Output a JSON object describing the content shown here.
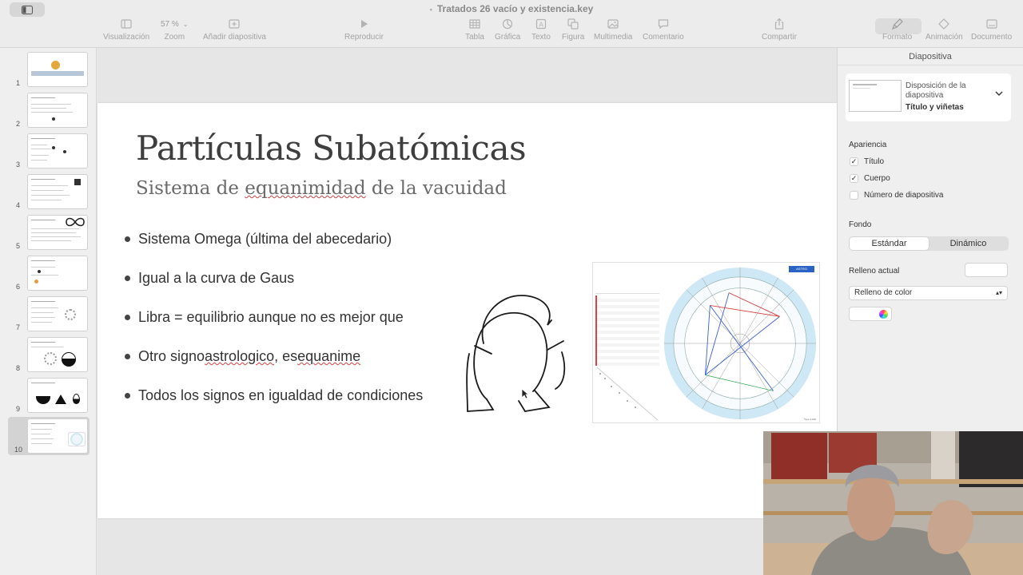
{
  "window": {
    "title": "Tratados 26 vacío y existencia.key"
  },
  "toolbar": {
    "view": "Visualización",
    "zoom_value": "57 %",
    "zoom": "Zoom",
    "add_slide": "Añadir diapositiva",
    "play": "Reproducir",
    "table": "Tabla",
    "chart": "Gráfica",
    "text": "Texto",
    "shape": "Figura",
    "media": "Multimedia",
    "comment": "Comentario",
    "share": "Compartir",
    "format": "Formato",
    "animate": "Animación",
    "document": "Documento"
  },
  "navigator": {
    "slides": [
      {
        "num": "1"
      },
      {
        "num": "2"
      },
      {
        "num": "3"
      },
      {
        "num": "4"
      },
      {
        "num": "5"
      },
      {
        "num": "6"
      },
      {
        "num": "7"
      },
      {
        "num": "8"
      },
      {
        "num": "9"
      },
      {
        "num": "10"
      }
    ],
    "selected": "10"
  },
  "slide": {
    "title": "Partículas Subatómicas",
    "subtitle_pre": "Sistema de ",
    "subtitle_mark": "equanimidad",
    "subtitle_post": " de la vacuidad",
    "bullets": [
      {
        "pre": "Sistema Omega (última del abecedario)",
        "mark": "",
        "post": ""
      },
      {
        "pre": "Igual a la curva de Gaus",
        "mark": "",
        "post": ""
      },
      {
        "pre": "Libra = equilibrio aunque no es mejor que",
        "mark": "",
        "post": ""
      },
      {
        "pre": "Otro signo ",
        "mark": "astrologico",
        "post": ", es "
      },
      {
        "pre": "Todos los signos en igualdad de condiciones",
        "mark": "",
        "post": ""
      }
    ],
    "bullet4_tail": "equanime"
  },
  "inspector": {
    "header": "Diapositiva",
    "layout_label": "Disposición de la diapositiva",
    "layout_value": "Título y viñetas",
    "appearance": "Apariencia",
    "check_title": "Título",
    "check_body": "Cuerpo",
    "check_number": "Número de diapositiva",
    "background": "Fondo",
    "seg_standard": "Estándar",
    "seg_dynamic": "Dinámico",
    "current_fill": "Relleno actual",
    "fill_type": "Relleno de color",
    "accent": "#2a63c4"
  }
}
